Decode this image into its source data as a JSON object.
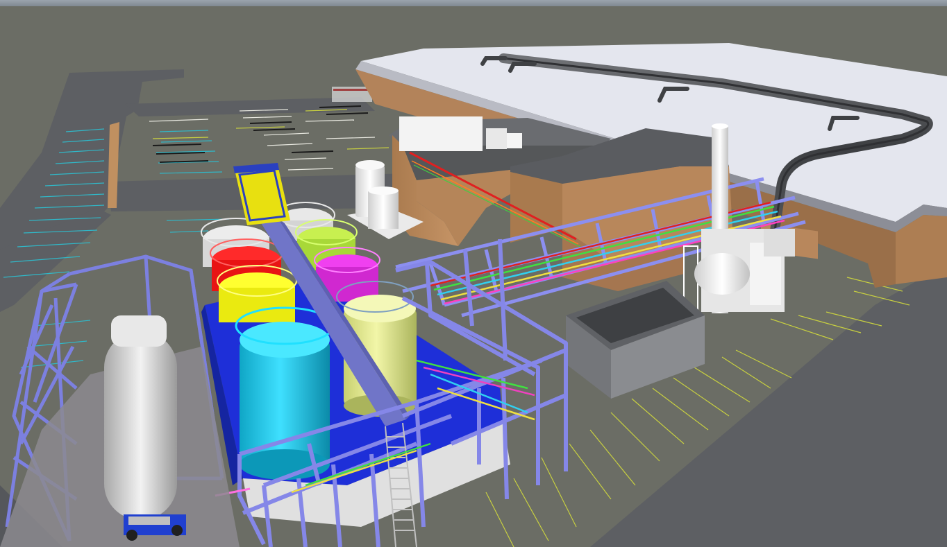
{
  "scene": {
    "colors": {
      "ground": "#6b6d65",
      "pavement": "#5e6063",
      "roof": "#e6e8ef",
      "brick": "#b8865a",
      "steel": "#7f82d8",
      "duct": "#4a4c4f",
      "tank_cyan": "#16c8e8",
      "tank_yellow": "#f0f020",
      "tank_red": "#f01818",
      "tank_olive": "#b8e048",
      "tank_magenta": "#e038e0",
      "tank_khaki": "#e0e890",
      "tank_white": "#e8e8e8",
      "skid_blue": "#2030d0",
      "truck_tank": "#d8d8d8"
    },
    "icons": [
      "industrial-plant-3d-model"
    ]
  }
}
